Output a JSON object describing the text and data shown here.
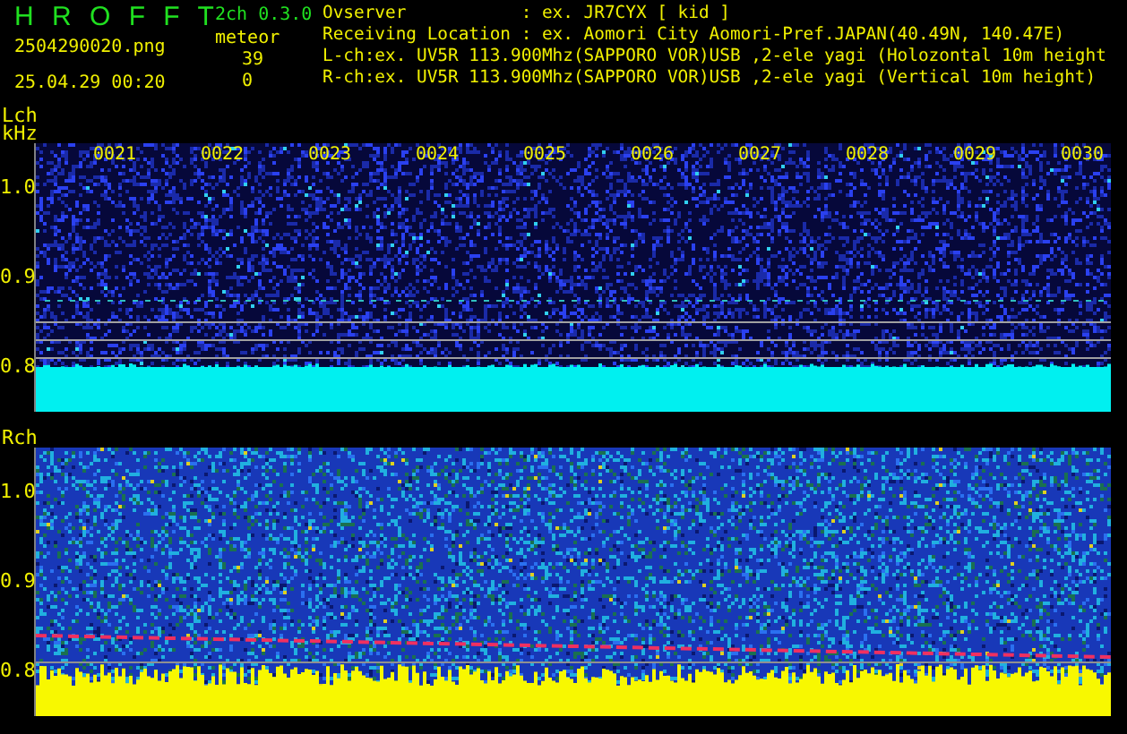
{
  "app": {
    "logo": "H R O F F T",
    "version": "2ch 0.3.0",
    "file": "2504290020.png",
    "timestamp": "25.04.29 00:20",
    "mode": "meteor",
    "counts": [
      "39",
      "0"
    ]
  },
  "info": [
    "Ovserver           : ex. JR7CYX [ kid ]",
    "Receiving Location : ex. Aomori City Aomori-Pref.JAPAN(40.49N, 140.47E)",
    "L-ch:ex. UV5R 113.900Mhz(SAPPORO VOR)USB ,2-ele yagi (Holozontal 10m height",
    "R-ch:ex. UV5R 113.900Mhz(SAPPORO VOR)USB ,2-ele yagi (Vertical 10m height)"
  ],
  "panels": [
    {
      "kind": "left",
      "label": "Lch",
      "unit": "kHz",
      "time_labels": [
        "0021",
        "0022",
        "0023",
        "0024",
        "0025",
        "0026",
        "0027",
        "0028",
        "0029",
        "0030"
      ],
      "y_labels": [
        "1.0",
        "0.9",
        "0.8"
      ]
    },
    {
      "kind": "right",
      "label": "Rch",
      "y_labels": [
        "1.0",
        "0.9",
        "0.8"
      ]
    }
  ]
}
